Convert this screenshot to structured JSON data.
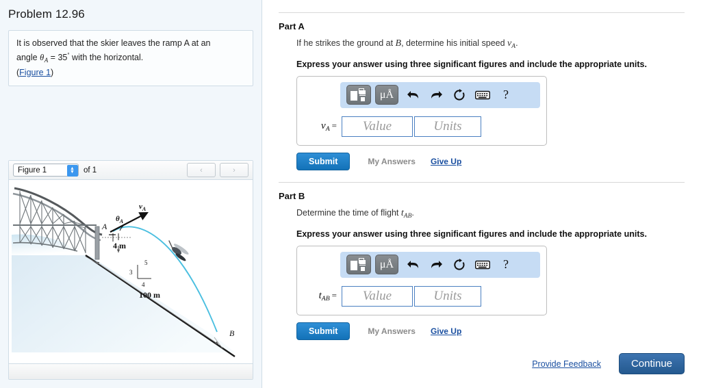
{
  "problem": {
    "title": "Problem 12.96",
    "statement_line1": "It is observed that the skier leaves the ramp A at an",
    "statement_line2_pre": "angle ",
    "statement_theta": "θ",
    "statement_theta_sub": "A",
    "statement_line2_post": " = 35",
    "statement_degree": "°",
    "statement_line2_end": " with the horizontal.",
    "figure_link": "Figure 1",
    "figure_link_open": "(",
    "figure_link_close": ")"
  },
  "figure_panel": {
    "select_value": "Figure 1",
    "of_text": "of 1",
    "prev_label": "‹",
    "next_label": "›",
    "stepper_up": "▲",
    "stepper_down": "▼",
    "diagram": {
      "point_a": "A",
      "point_b": "B",
      "angle_label": "θ",
      "angle_sub": "A",
      "velocity_label": "v",
      "velocity_sub": "A",
      "height_label": "4 m",
      "slope_distance_label": "100 m",
      "slope_rise": "3",
      "slope_run": "4",
      "slope_hyp": "5"
    }
  },
  "parts": [
    {
      "title": "Part A",
      "question_pre": "If he strikes the ground at ",
      "question_var1": "B",
      "question_mid": ", determine his initial speed ",
      "question_var2": "v",
      "question_var2_sub": "A",
      "question_end": ".",
      "instruction": "Express your answer using three significant figures and include the appropriate units.",
      "answer_label_var": "v",
      "answer_label_sub": "A",
      "answer_label_eq": "=",
      "value_placeholder": "Value",
      "units_placeholder": "Units",
      "submit_label": "Submit",
      "my_answers_label": "My Answers",
      "give_up_label": "Give Up"
    },
    {
      "title": "Part B",
      "question_pre": "Determine the time of flight ",
      "question_var1": "t",
      "question_var1_sub": "AB",
      "question_mid": "",
      "question_var2": "",
      "question_var2_sub": "",
      "question_end": ".",
      "instruction": "Express your answer using three significant figures and include the appropriate units.",
      "answer_label_var": "t",
      "answer_label_sub": "AB",
      "answer_label_eq": "=",
      "value_placeholder": "Value",
      "units_placeholder": "Units",
      "submit_label": "Submit",
      "my_answers_label": "My Answers",
      "give_up_label": "Give Up"
    }
  ],
  "toolbar": {
    "template_icon": "math-template-icon",
    "units_label": "μÅ",
    "undo_icon": "undo-arrow-icon",
    "redo_icon": "redo-arrow-icon",
    "reset_icon": "reset-circular-arrow-icon",
    "keyboard_icon": "keyboard-icon",
    "help_label": "?"
  },
  "footer": {
    "provide_feedback": "Provide Feedback",
    "continue_label": "Continue"
  },
  "colors": {
    "submit_blue": "#1372b8",
    "continue_blue": "#2b6cb0",
    "link_blue": "#1a4fa0",
    "toolbar_blue": "#c6dcf4",
    "panel_bg": "#f2f7fb",
    "border_gray": "#cfdce6",
    "trajectory_cyan": "#4bbfe0"
  }
}
